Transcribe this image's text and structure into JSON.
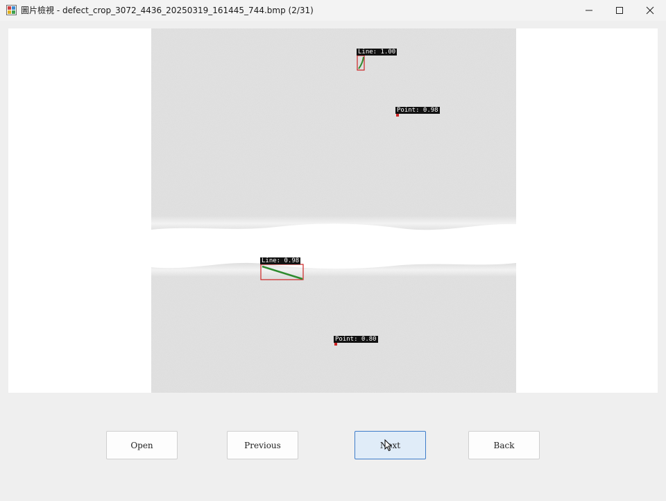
{
  "window": {
    "title": "圖片檢視 - defect_crop_3072_4436_20250319_161445_744.bmp (2/31)",
    "icon": "app-window-icon",
    "controls": {
      "minimize_icon": "minimize-icon",
      "maximize_icon": "maximize-icon",
      "close_icon": "close-icon"
    }
  },
  "viewer": {
    "detections": [
      {
        "label": "Line: 1.00",
        "class": "Line",
        "score": 1.0
      },
      {
        "label": "Point: 0.98",
        "class": "Point",
        "score": 0.98
      },
      {
        "label": "Line: 0.98",
        "class": "Line",
        "score": 0.98
      },
      {
        "label": "Point: 0.80",
        "class": "Point",
        "score": 0.8
      }
    ],
    "colors": {
      "box": "#cc2222",
      "line": "#2e8b2e",
      "label_bg": "#111111"
    }
  },
  "buttons": {
    "open": "Open",
    "previous": "Previous",
    "next": "Next",
    "back": "Back"
  }
}
